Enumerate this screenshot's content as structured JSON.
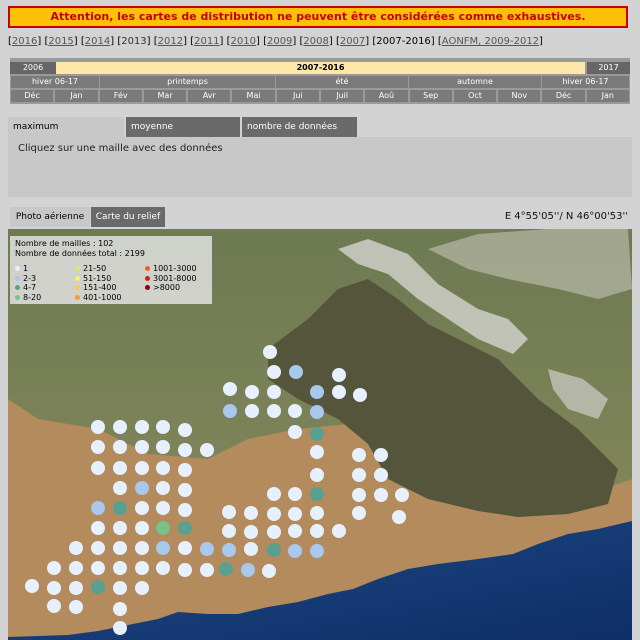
{
  "warning": "Attention, les cartes de distribution ne peuvent être considérées comme exhaustives.",
  "years": {
    "links": [
      "2016",
      "2015",
      "2014",
      "2013",
      "2012",
      "2011",
      "2010",
      "2009",
      "2008",
      "2007"
    ],
    "current": "2007-2016",
    "extra": "AONFM, 2009-2012"
  },
  "timeline": {
    "row1": [
      "2006",
      "2007-2016",
      "2017"
    ],
    "row2": [
      "hiver 06-17",
      "printemps",
      "été",
      "automne",
      "hiver 06-17"
    ],
    "row3": [
      "Déc",
      "Jan",
      "Fév",
      "Mar",
      "Avr",
      "Mai",
      "Jui",
      "Juil",
      "Aoû",
      "Sep",
      "Oct",
      "Nov",
      "Déc",
      "Jan"
    ]
  },
  "tabs": [
    "maximum",
    "moyenne",
    "nombre de données"
  ],
  "info_message": "Cliquez sur une maille avec des données",
  "map_tabs": [
    "Photo aérienne",
    "Carte du relief"
  ],
  "coords": "E 4°55'05''/ N 46°00'53''",
  "legend": {
    "mailles": "Nombre de mailles : 102",
    "donnees": "Nombre de données total : 2199",
    "classes": [
      {
        "label": "1",
        "color": "#e6f0ff"
      },
      {
        "label": "2-3",
        "color": "#a9c8ee"
      },
      {
        "label": "4-7",
        "color": "#5aa090"
      },
      {
        "label": "8-20",
        "color": "#7cc08a"
      },
      {
        "label": "21-50",
        "color": "#d8e870"
      },
      {
        "label": "51-150",
        "color": "#f4f070"
      },
      {
        "label": "151-400",
        "color": "#f4d050"
      },
      {
        "label": "401-1000",
        "color": "#f0a030"
      },
      {
        "label": "1001-3000",
        "color": "#f06020"
      },
      {
        "label": "3001-8000",
        "color": "#d02010"
      },
      {
        "label": ">8000",
        "color": "#900000"
      }
    ]
  }
}
